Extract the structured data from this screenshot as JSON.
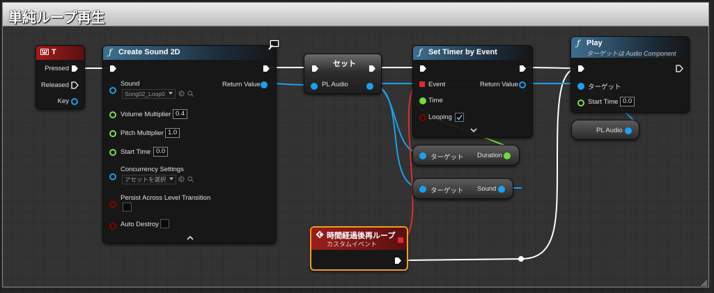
{
  "comment": {
    "title": "単純ループ再生"
  },
  "nodes": {
    "key_t": {
      "title": "T",
      "pins": {
        "pressed": "Pressed",
        "released": "Released",
        "key": "Key"
      }
    },
    "create_sound": {
      "title": "Create Sound 2D",
      "pins": {
        "sound": "Sound",
        "sound_value": "Song02_Loop0",
        "return_value": "Return Value",
        "volume": "Volume Multiplier",
        "volume_value": "0.4",
        "pitch": "Pitch Multiplier",
        "pitch_value": "1.0",
        "start_time": "Start Time",
        "start_time_value": "0.0",
        "concurrency": "Concurrency Settings",
        "concurrency_value": "アセットを選択",
        "persist": "Persist Across Level Transition",
        "auto_destroy": "Auto Destroy"
      }
    },
    "set_node": {
      "title": "セット",
      "pins": {
        "pl_audio": "PL Audio"
      }
    },
    "set_timer": {
      "title": "Set Timer by Event",
      "pins": {
        "event": "Event",
        "time": "Time",
        "looping": "Looping",
        "return_value": "Return Value"
      }
    },
    "play": {
      "title": "Play",
      "subtitle": "ターゲットは Audio Component",
      "pins": {
        "target": "ターゲット",
        "start_time": "Start Time",
        "start_time_value": "0.0"
      }
    },
    "pl_audio_var": {
      "label": "PL Audio"
    },
    "duration_node": {
      "target": "ターゲット",
      "output": "Duration"
    },
    "sound_node": {
      "target": "ターゲット",
      "output": "Sound"
    },
    "custom_event": {
      "title": "時間経過後再ループ",
      "subtitle": "カスタムイベント"
    }
  },
  "colors": {
    "exec": "#ffffff",
    "object": "#00a0ff",
    "float": "#9dff6a",
    "bool": "#8c0000",
    "delegate": "#ff3838",
    "event_outline": "#f0a020"
  }
}
